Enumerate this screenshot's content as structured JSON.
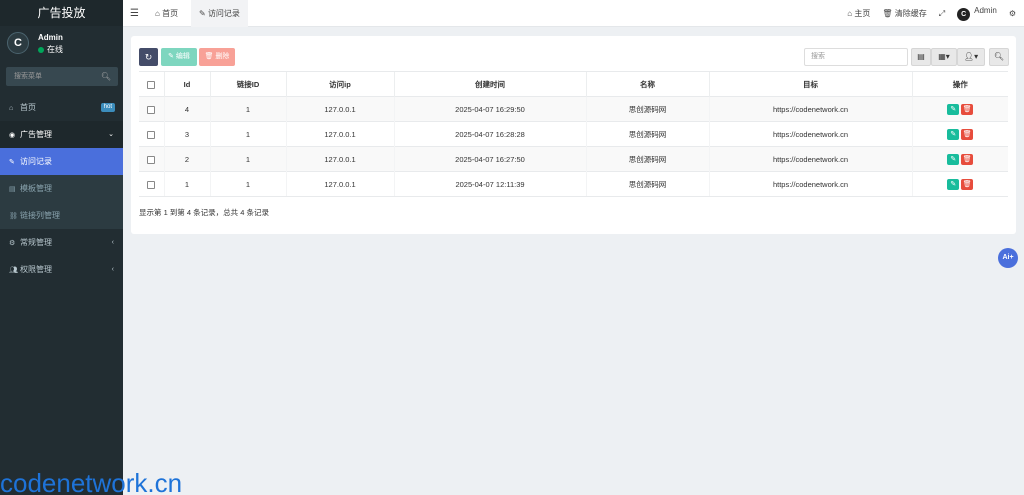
{
  "sidebar": {
    "brand": "广告投放",
    "user": {
      "name": "Admin",
      "status": "在线",
      "avatar_letter": "C"
    },
    "search_placeholder": "搜索菜单",
    "items": [
      {
        "label": "首页",
        "icon": "home-icon",
        "badge": "hot"
      },
      {
        "label": "广告管理",
        "icon": "globe-icon",
        "caret": "⌄"
      },
      {
        "label": "访问记录",
        "icon": "pencil-icon"
      },
      {
        "label": "模板管理",
        "icon": "table-icon"
      },
      {
        "label": "链接列管理",
        "icon": "link-icon"
      },
      {
        "label": "常规管理",
        "icon": "cogs-icon",
        "caret": "‹"
      },
      {
        "label": "权限管理",
        "icon": "group-icon",
        "caret": "‹"
      }
    ]
  },
  "topbar": {
    "tabs": [
      {
        "label": "首页"
      },
      {
        "label": "访问记录"
      }
    ],
    "right": {
      "home": "主页",
      "clear_cache": "清除缓存",
      "user": "Admin"
    }
  },
  "toolbar": {
    "edit_label": "编辑",
    "delete_label": "删除",
    "search_placeholder": "搜索"
  },
  "table": {
    "columns": [
      "Id",
      "链接ID",
      "访问ip",
      "创建时间",
      "名称",
      "目标",
      "操作"
    ],
    "rows": [
      [
        "4",
        "1",
        "127.0.0.1",
        "2025-04-07 16:29:50",
        "思创源码网",
        "https://codenetwork.cn"
      ],
      [
        "3",
        "1",
        "127.0.0.1",
        "2025-04-07 16:28:28",
        "思创源码网",
        "https://codenetwork.cn"
      ],
      [
        "2",
        "1",
        "127.0.0.1",
        "2025-04-07 16:27:50",
        "思创源码网",
        "https://codenetwork.cn"
      ],
      [
        "1",
        "1",
        "127.0.0.1",
        "2025-04-07 12:11:39",
        "思创源码网",
        "https://codenetwork.cn"
      ]
    ],
    "pagination_text": "显示第 1 到第 4 条记录，总共 4 条记录"
  },
  "ai_button": "Ai+",
  "watermark": "codenetwork.cn",
  "colors": {
    "sidebar": "#222d32",
    "accent": "#4a6fdc",
    "success": "#18bc9c",
    "danger": "#e74c3c"
  }
}
